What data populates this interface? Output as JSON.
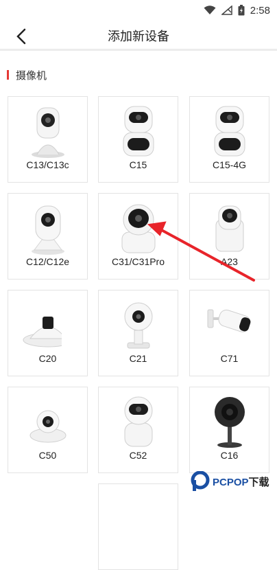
{
  "status_bar": {
    "time": "2:58",
    "icons": [
      "wifi-icon",
      "no-signal-icon",
      "battery-charging-icon"
    ]
  },
  "header": {
    "back_icon": "chevron-left-icon",
    "title": "添加新设备"
  },
  "section": {
    "title": "摄像机",
    "accent_color": "#e53935"
  },
  "devices": [
    {
      "label": "C13/C13c",
      "icon": "camera-c13-icon"
    },
    {
      "label": "C15",
      "icon": "camera-c15-icon"
    },
    {
      "label": "C15-4G",
      "icon": "camera-c15-4g-icon"
    },
    {
      "label": "C12/C12e",
      "icon": "camera-c12-icon"
    },
    {
      "label": "C31/C31Pro",
      "icon": "camera-c31-icon"
    },
    {
      "label": "A23",
      "icon": "camera-a23-icon"
    },
    {
      "label": "C20",
      "icon": "camera-c20-icon"
    },
    {
      "label": "C21",
      "icon": "camera-c21-icon"
    },
    {
      "label": "C71",
      "icon": "camera-c71-icon"
    },
    {
      "label": "C50",
      "icon": "camera-c50-icon"
    },
    {
      "label": "C52",
      "icon": "camera-c52-icon"
    },
    {
      "label": "C16",
      "icon": "camera-c16-icon"
    }
  ],
  "annotation": {
    "color": "#e8242a",
    "icon": "red-arrow-pointer"
  },
  "watermark": {
    "part1": "PCPOP",
    "part2": "下载"
  }
}
